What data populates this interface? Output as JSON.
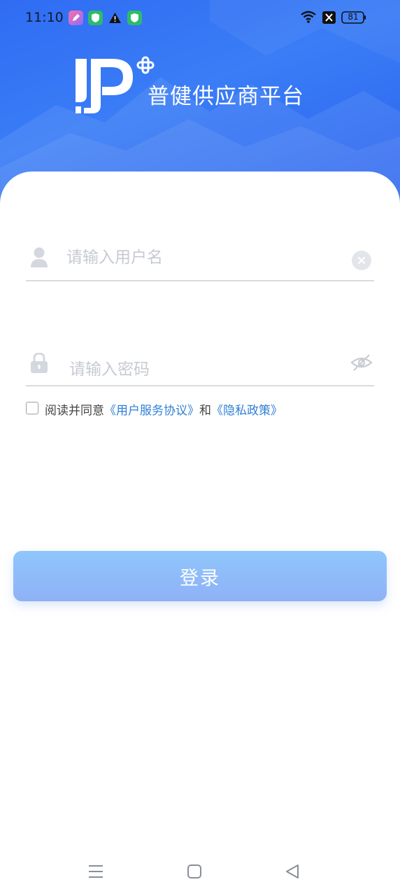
{
  "status_bar": {
    "time": "11:10",
    "battery": "81",
    "icons": [
      "pencil-app-icon",
      "shield-app-icon",
      "warning-icon",
      "shield-app-icon",
      "wifi-icon",
      "sim-off-icon",
      "battery-icon"
    ]
  },
  "brand": {
    "title": "普健供应商平台",
    "logo_icon": "dp-plus-logo",
    "primary_color": "#2f6cf3"
  },
  "login_form": {
    "username_placeholder": "请输入用户名",
    "password_placeholder": "请输入密码",
    "agree_prefix": "阅读并同意",
    "user_agreement": "《用户服务协议》",
    "conjunction": "和",
    "privacy_policy": "《隐私政策》",
    "agreed": false,
    "login_label": "登录"
  },
  "nav_bar": {
    "icons": [
      "menu-icon",
      "home-icon",
      "back-icon"
    ]
  }
}
